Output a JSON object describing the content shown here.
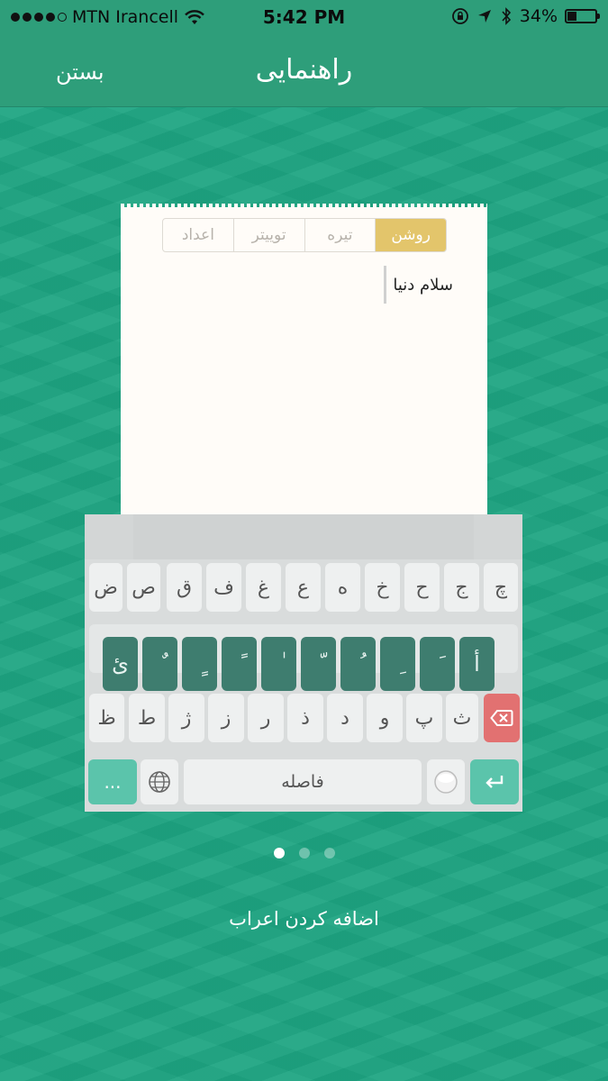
{
  "status_bar": {
    "carrier": "MTN Irancell",
    "time": "5:42 PM",
    "battery_percent": "34%",
    "battery_level": 0.34,
    "signal_dots_filled": 4,
    "signal_dots_total": 5
  },
  "nav": {
    "title": "راهنمایی",
    "close_label": "بستن"
  },
  "preview": {
    "tabs": [
      {
        "label": "روشن",
        "active": true
      },
      {
        "label": "تیره",
        "active": false
      },
      {
        "label": "توییتر",
        "active": false
      },
      {
        "label": "اعداد",
        "active": false
      }
    ],
    "sample_text": "سلام دنیا"
  },
  "keyboard": {
    "row1": [
      "ض",
      "ص",
      "ق",
      "ف",
      "غ",
      "ع",
      "ه",
      "خ",
      "ح",
      "ج",
      "چ"
    ],
    "diacritics_popup": [
      "ئ",
      "ٌ",
      "ٍ",
      "ً",
      "ٰ",
      "ّ",
      "ُ",
      "ِ",
      "َ",
      "أ"
    ],
    "row3": [
      "ظ",
      "ط",
      "ژ",
      "ز",
      "ر",
      "ذ",
      "د",
      "و",
      "پ",
      "ث"
    ],
    "space_label": "فاصله",
    "more_label": "...",
    "delete_icon": "backspace-icon",
    "enter_icon": "return-icon",
    "globe_icon": "globe-icon",
    "emoji_icon": "emoji-icon"
  },
  "pager": {
    "total": 3,
    "active_index": 0
  },
  "caption": "اضافه کردن اعراب",
  "colors": {
    "background": "#1ea582",
    "navbar": "#2e9e7a",
    "active_tab": "#e3c56b",
    "delete_key": "#e27171",
    "action_key": "#5bc4ab",
    "popup_key": "#3e7d6f"
  }
}
